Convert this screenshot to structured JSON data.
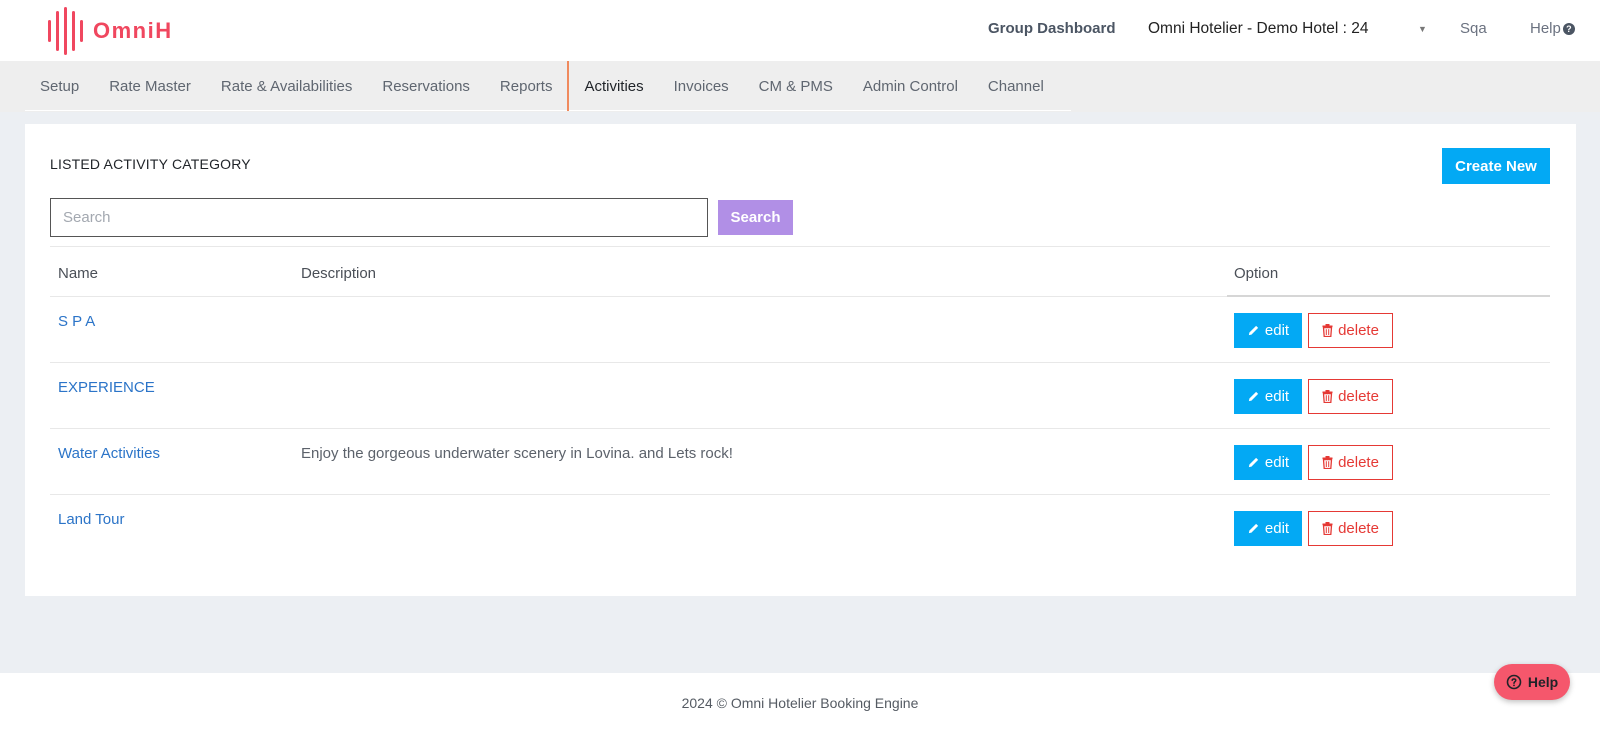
{
  "brand": {
    "name": "OmniH",
    "color": "#f0475f"
  },
  "header": {
    "group_dashboard": "Group Dashboard",
    "hotel_selector": "Omni Hotelier - Demo Hotel : 24",
    "user": "Sqa",
    "help": "Help"
  },
  "nav": {
    "items": [
      "Setup",
      "Rate Master",
      "Rate & Availabilities",
      "Reservations",
      "Reports",
      "Activities",
      "Invoices",
      "CM & PMS",
      "Admin Control",
      "Channel"
    ],
    "active": "Activities"
  },
  "page": {
    "title": "LISTED ACTIVITY CATEGORY",
    "create_label": "Create New",
    "search_placeholder": "Search",
    "search_value": "",
    "search_label": "Search"
  },
  "table": {
    "headers": {
      "name": "Name",
      "description": "Description",
      "option": "Option"
    },
    "edit_label": "edit",
    "delete_label": "delete",
    "rows": [
      {
        "name": "S P A",
        "description": ""
      },
      {
        "name": "EXPERIENCE",
        "description": ""
      },
      {
        "name": "Water Activities",
        "description": "Enjoy the gorgeous underwater scenery in Lovina. and Lets rock!"
      },
      {
        "name": "Land Tour",
        "description": ""
      }
    ]
  },
  "footer": {
    "text": "2024 © Omni Hotelier Booking Engine"
  },
  "help_widget": {
    "label": "Help"
  },
  "colors": {
    "primary": "#03a9f4",
    "danger": "#e53935",
    "search_button": "#b18fe6",
    "help_widget": "#f5576c",
    "nav_active_border": "#f08a5d"
  }
}
